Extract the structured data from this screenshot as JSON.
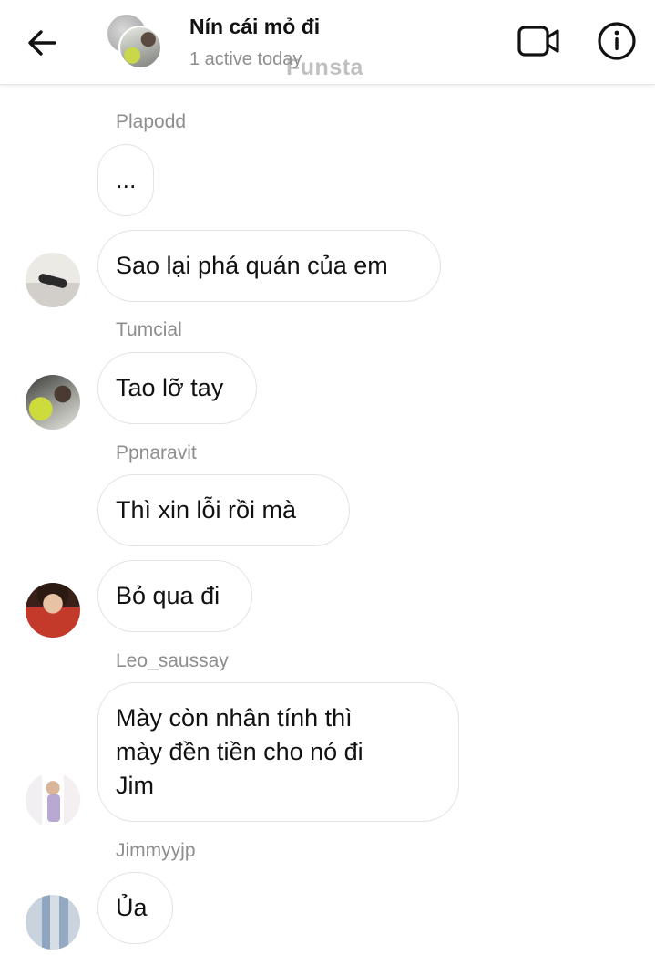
{
  "header": {
    "title": "Nín cái mỏ đi",
    "subtitle": "1 active today",
    "watermark": "Funsta",
    "icons": {
      "back": "arrow-left-icon",
      "video": "video-camera-icon",
      "info": "info-circle-icon"
    }
  },
  "messages": [
    {
      "sender": "Plapodd",
      "text": "..."
    },
    {
      "sender": "",
      "text": "Sao lại phá quán của em"
    },
    {
      "sender": "Tumcial",
      "text": "Tao lỡ tay"
    },
    {
      "sender": "Ppnaravit",
      "text": "Thì xin lỗi rồi mà"
    },
    {
      "sender": "",
      "text": "Bỏ qua đi"
    },
    {
      "sender": "Leo_saussay",
      "text_lines": [
        "Mày còn nhân tính thì",
        "mày đền tiền cho nó đi",
        "Jim"
      ]
    },
    {
      "sender": "Jimmyyjp",
      "text": "Ủa"
    }
  ]
}
